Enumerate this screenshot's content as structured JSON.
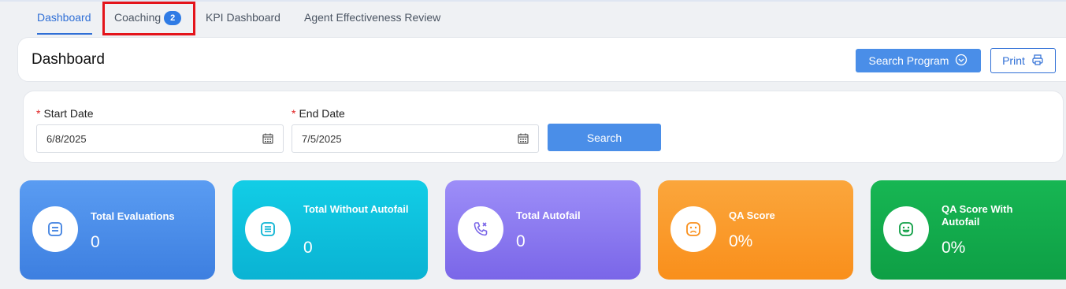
{
  "tabs": [
    {
      "label": "Dashboard",
      "active": true
    },
    {
      "label": "Coaching",
      "badge": "2"
    },
    {
      "label": "KPI Dashboard"
    },
    {
      "label": "Agent Effectiveness Review"
    }
  ],
  "header": {
    "title": "Dashboard",
    "search_program_label": "Search Program",
    "print_label": "Print"
  },
  "filters": {
    "start_date_label": "Start Date",
    "start_date_value": "6/8/2025",
    "end_date_label": "End Date",
    "end_date_value": "7/5/2025",
    "required_marker": "*",
    "search_label": "Search"
  },
  "stats": [
    {
      "label": "Total Evaluations",
      "value": "0",
      "color_start": "#5a9cf2",
      "color_end": "#3d7fe0",
      "icon": "list-icon"
    },
    {
      "label": "Total Without Autofail",
      "value": "0",
      "color_start": "#12cde6",
      "color_end": "#0ab3d3",
      "icon": "list-icon"
    },
    {
      "label": "Total Autofail",
      "value": "0",
      "color_start": "#9d8ef8",
      "color_end": "#7a66e8",
      "icon": "phone-missed-icon"
    },
    {
      "label": "QA Score",
      "value": "0%",
      "color_start": "#fba63c",
      "color_end": "#f98f1b",
      "icon": "sad-face-icon"
    },
    {
      "label": "QA Score With Autofail",
      "value": "0%",
      "color_start": "#17b653",
      "color_end": "#0e9f45",
      "icon": "happy-face-icon"
    }
  ]
}
